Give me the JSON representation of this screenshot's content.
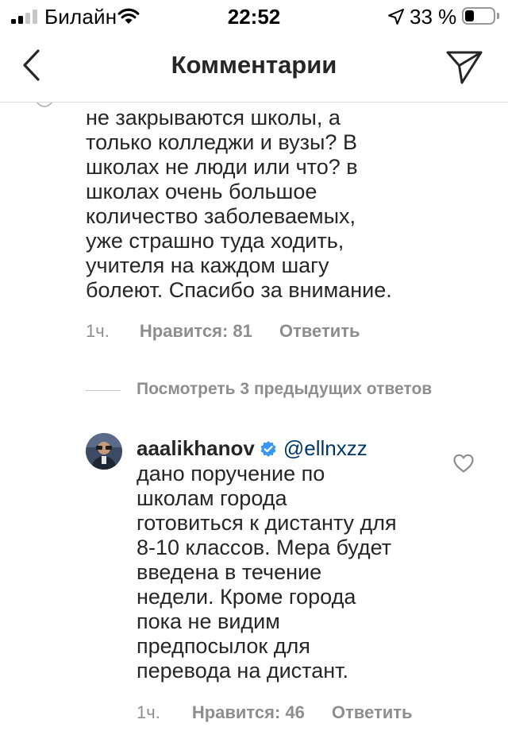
{
  "status_bar": {
    "carrier": "Билайн",
    "time": "22:52",
    "battery_percent": "33 %",
    "battery_level": 0.33,
    "signal_icon": "cellular-signal-icon",
    "wifi_icon": "wifi-icon",
    "location_icon": "location-arrow-icon",
    "battery_icon": "battery-icon"
  },
  "nav": {
    "title": "Комментарии",
    "back_icon": "chevron-left-icon",
    "share_icon": "paper-plane-icon"
  },
  "comments": [
    {
      "text": "не закрываются школы, а\nтолько колледжи и вузы? В\nшколах не люди или что? в\nшколах очень большое\nколичество заболеваемых,\nуже страшно туда ходить,\nучителя на каждом шагу\nболеют. Спасибо за внимание.",
      "time": "1ч.",
      "likes": "Нравится: 81",
      "reply": "Ответить"
    }
  ],
  "view_replies": "Посмотреть 3 предыдущих ответов",
  "reply": {
    "username": "aaalikhanov",
    "verified_icon": "verified-badge-icon",
    "mention": "@ellnxzz",
    "text": "дано поручение по\nшколам города\nготовиться к дистанту для\n8-10 классов. Мера будет\nвведена в течение\nнедели. Кроме города\nпока не видим\nпредпосылок для\nперевода на дистант.",
    "time": "1ч.",
    "likes": "Нравится: 46",
    "reply": "Ответить",
    "like_icon": "heart-outline-icon"
  },
  "colors": {
    "text": "#262626",
    "secondary": "#8e8e8e",
    "mention": "#00376b",
    "verified": "#3897f0",
    "divider": "#dbdbdb"
  }
}
